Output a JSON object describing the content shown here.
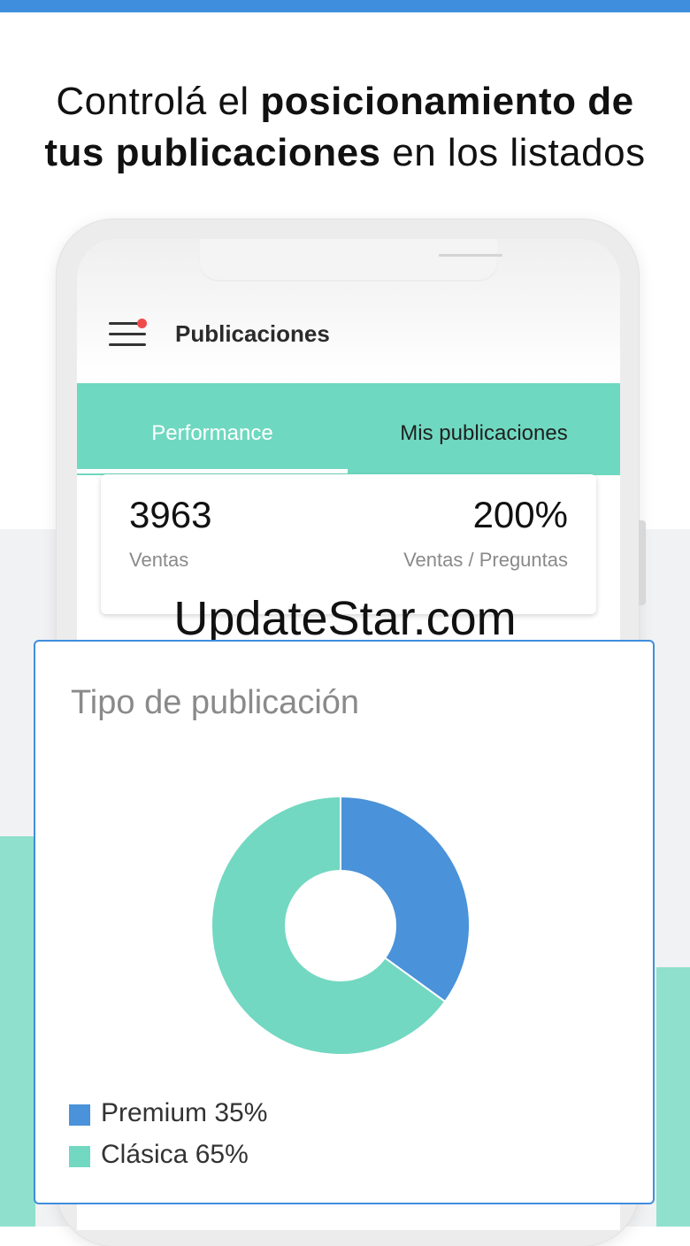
{
  "headline": {
    "part1": "Controlá el ",
    "bold1": "posicionamiento de",
    "bold2": "tus publicaciones",
    "part2": " en los listados"
  },
  "app": {
    "title": "Publicaciones",
    "tabs": [
      {
        "label": "Performance",
        "active": true
      },
      {
        "label": "Mis publicaciones",
        "active": false
      }
    ]
  },
  "stats": {
    "sales_value": "3963",
    "sales_label": "Ventas",
    "ratio_value": "200%",
    "ratio_label": "Ventas / Preguntas"
  },
  "watermark": "UpdateStar.com",
  "colors": {
    "accent_blue": "#3f8ede",
    "teal": "#6fd8c0",
    "notification_dot": "#ef4b4b"
  },
  "chart_data": {
    "type": "pie",
    "title": "Tipo de publicación",
    "slices": [
      {
        "name": "Premium",
        "value": 35,
        "label": "Premium 35%",
        "color": "#4a92d9"
      },
      {
        "name": "Clásica",
        "value": 65,
        "label": "Clásica 65%",
        "color": "#72d8c1"
      }
    ],
    "donut": true,
    "legend": "bottom-left"
  }
}
